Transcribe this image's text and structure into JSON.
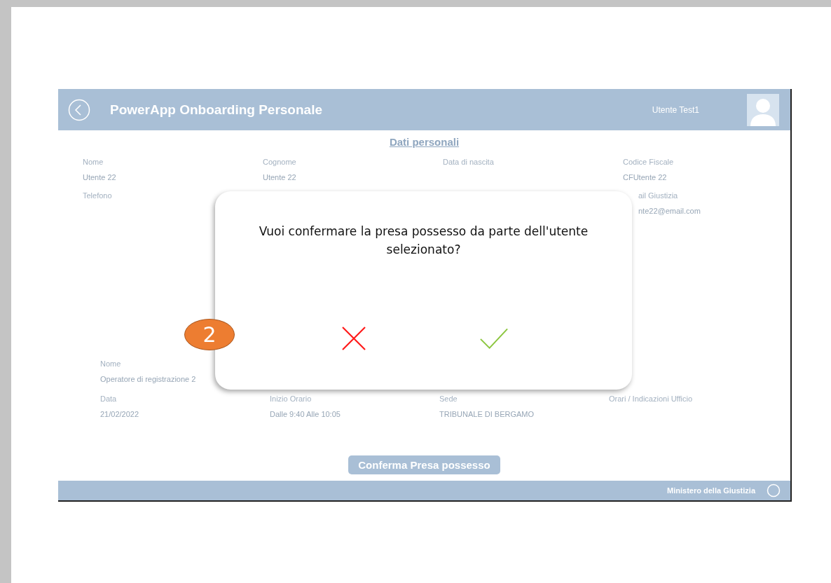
{
  "app": {
    "header": {
      "title": "PowerApp Onboarding Personale",
      "user": "Utente Test1"
    },
    "section_title": "Dati personali",
    "personal_fields": [
      {
        "label": "Nome",
        "value": "Utente 22"
      },
      {
        "label": "Cognome",
        "value": "Utente 22"
      },
      {
        "label": "Data di nascita"
      },
      {
        "label": "Codice Fiscale",
        "value": "CFUtente 22"
      },
      {
        "label": "Telefono"
      },
      {
        "label": "ail Giustizia",
        "value": "nte22@email.com"
      }
    ],
    "operator_fields": [
      {
        "label": "Nome",
        "value": "Operatore di registrazione 2"
      }
    ],
    "appointment_fields": [
      {
        "label": "Data",
        "value": "21/02/2022"
      },
      {
        "label": "Inizio Orario",
        "value": "Dalle 9:40 Alle 10:05"
      },
      {
        "label": "Sede",
        "value": "TRIBUNALE DI BERGAMO"
      },
      {
        "label": "Orari / Indicazioni Ufficio"
      }
    ],
    "confirm_button": "Conferma Presa possesso",
    "footer": {
      "text": "Ministero della Giustizia"
    }
  },
  "dialog": {
    "message": "Vuoi confermare la presa possesso da parte dell'utente selezionato?",
    "buttons": [
      {
        "kind": "cancel"
      },
      {
        "kind": "confirm"
      }
    ]
  },
  "callout": {
    "number": "2"
  }
}
